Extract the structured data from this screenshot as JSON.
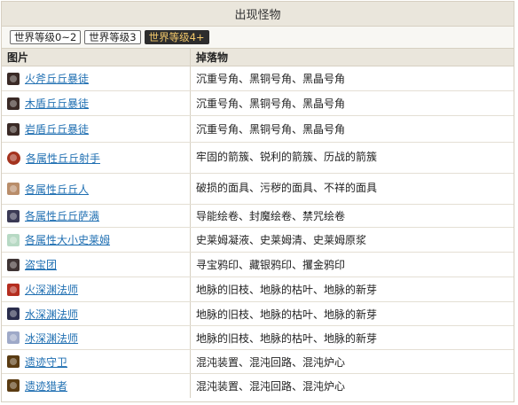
{
  "header": {
    "title": "出现怪物"
  },
  "tabs": [
    {
      "label": "世界等级0~2",
      "active": false
    },
    {
      "label": "世界等级3",
      "active": false
    },
    {
      "label": "世界等级4+",
      "active": true
    }
  ],
  "table": {
    "col_image": "图片",
    "col_drops": "掉落物",
    "rows": [
      {
        "name": "火斧丘丘暴徒",
        "drops": "沉重号角、黑铜号角、黑晶号角",
        "icon": "hilichurl-mitachurl-icon",
        "color": "#3a2a26"
      },
      {
        "name": "木盾丘丘暴徒",
        "drops": "沉重号角、黑铜号角、黑晶号角",
        "icon": "hilichurl-mitachurl-icon",
        "color": "#3a2a26"
      },
      {
        "name": "岩盾丘丘暴徒",
        "drops": "沉重号角、黑铜号角、黑晶号角",
        "icon": "hilichurl-mitachurl-icon",
        "color": "#3a2a26"
      },
      {
        "name": "各属性丘丘射手",
        "drops": "牢固的箭簇、锐利的箭簇、历战的箭簇",
        "icon": "hilichurl-shooter-icon",
        "color": "#a4331f"
      },
      {
        "name": "各属性丘丘人",
        "drops": "破损的面具、污秽的面具、不祥的面具",
        "icon": "hilichurl-icon",
        "color": "#b98d6a"
      },
      {
        "name": "各属性丘丘萨满",
        "drops": "导能绘卷、封魔绘卷、禁咒绘卷",
        "icon": "samachurl-icon",
        "color": "#3b3a55"
      },
      {
        "name": "各属性大小史莱姆",
        "drops": "史莱姆凝液、史莱姆清、史莱姆原浆",
        "icon": "slime-icon",
        "color": "#b7d9c4"
      },
      {
        "name": "盗宝团",
        "drops": "寻宝鸦印、藏银鸦印、攫金鸦印",
        "icon": "treasure-hoarder-icon",
        "color": "#3f3434"
      },
      {
        "name": "火深渊法师",
        "drops": "地脉的旧枝、地脉的枯叶、地脉的新芽",
        "icon": "abyss-mage-pyro-icon",
        "color": "#b42d1f"
      },
      {
        "name": "水深渊法师",
        "drops": "地脉的旧枝、地脉的枯叶、地脉的新芽",
        "icon": "abyss-mage-hydro-icon",
        "color": "#2a2d4c"
      },
      {
        "name": "冰深渊法师",
        "drops": "地脉的旧枝、地脉的枯叶、地脉的新芽",
        "icon": "abyss-mage-cryo-icon",
        "color": "#9ea9c8"
      },
      {
        "name": "遗迹守卫",
        "drops": "混沌装置、混沌回路、混沌炉心",
        "icon": "ruin-guard-icon",
        "color": "#5a3b12"
      },
      {
        "name": "遗迹猎者",
        "drops": "混沌装置、混沌回路、混沌炉心",
        "icon": "ruin-hunter-icon",
        "color": "#5a3b12"
      }
    ]
  }
}
